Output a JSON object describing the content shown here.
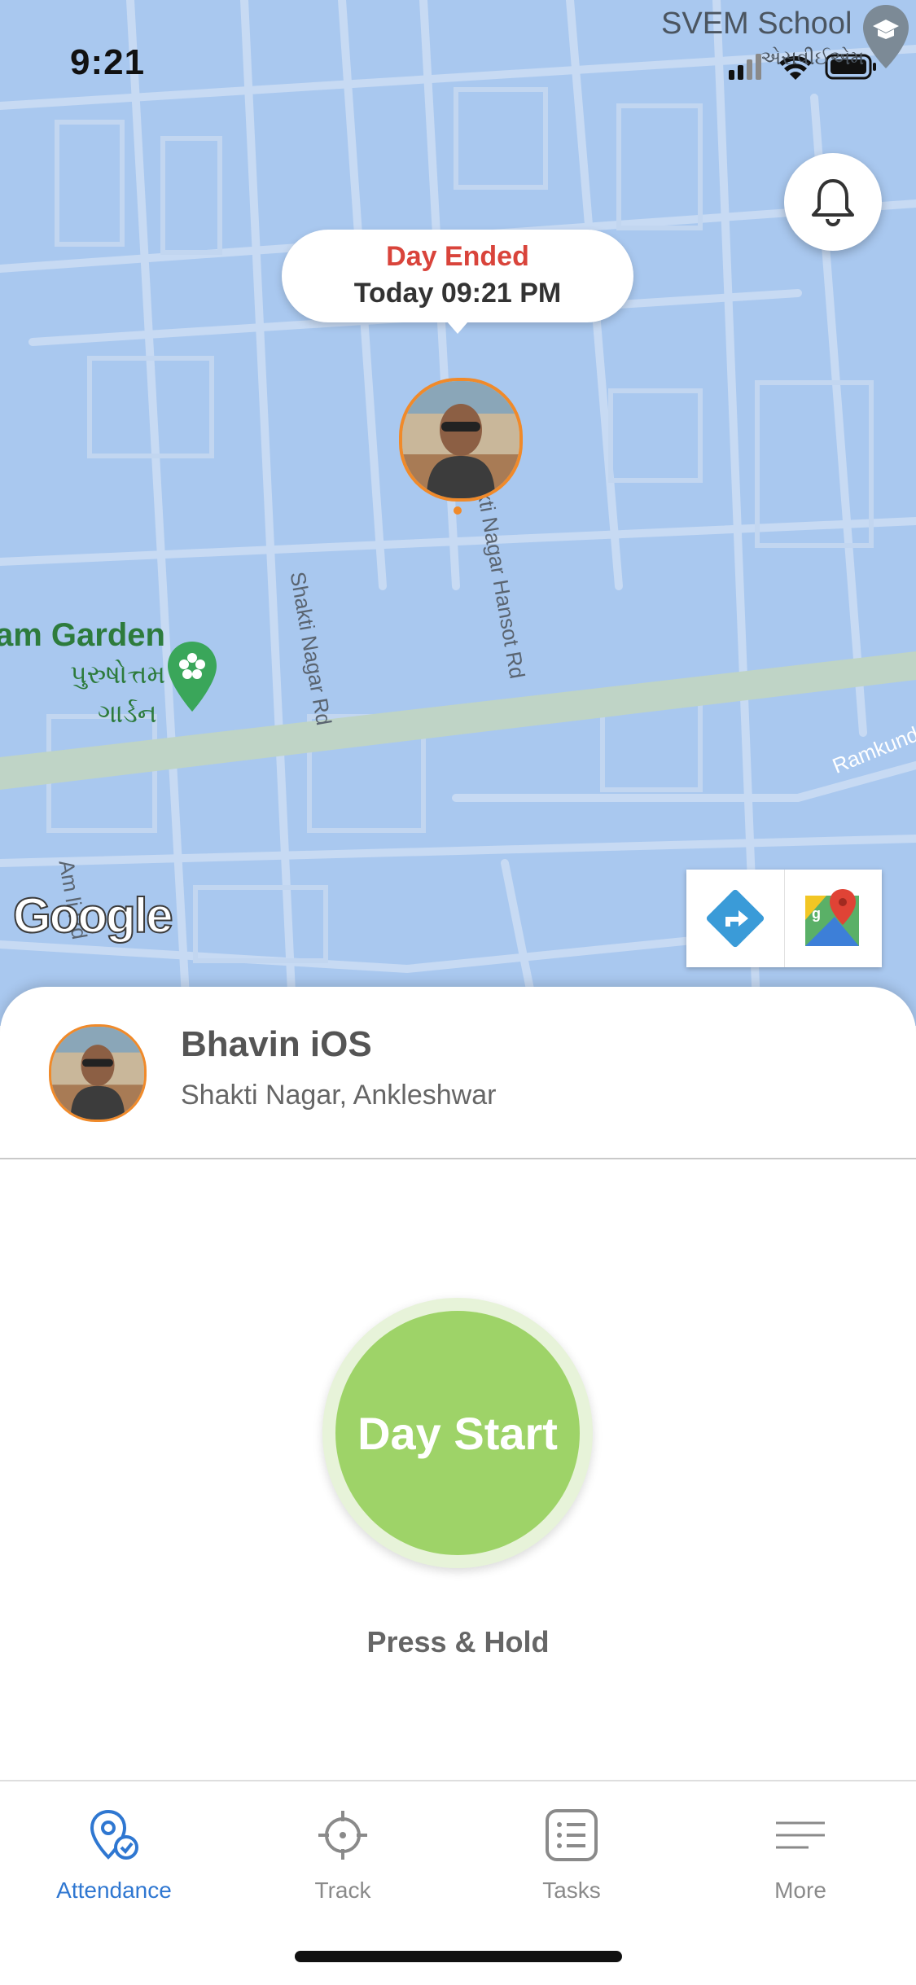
{
  "status_bar": {
    "time": "9:21"
  },
  "map": {
    "labels": {
      "school": "SVEM School",
      "school_sub": "એસવીઈએમ",
      "garden": "am Garden",
      "garden_gu_line1": "પુરુષોત્તમ",
      "garden_gu_line2": "ગાર્ડન",
      "road_shakti": "Shakti Nagar Rd",
      "road_hansot": "kti Nagar Hansot Rd",
      "road_ramkund": "Ramkund",
      "road_am": "Am        li Rd"
    },
    "logo_text": "Google",
    "bubble": {
      "title": "Day Ended",
      "subtitle": "Today 09:21 PM"
    },
    "colors": {
      "water": "#a9c8ef",
      "accent_orange": "#f08a2a",
      "ended_red": "#d9443b"
    }
  },
  "profile": {
    "name": "Bhavin iOS",
    "location": "Shakti Nagar, Ankleshwar"
  },
  "action": {
    "button_label": "Day Start",
    "hint": "Press & Hold",
    "color": "#9ed368"
  },
  "tabs": [
    {
      "label": "Attendance",
      "icon": "attendance-pin-icon",
      "active": true
    },
    {
      "label": "Track",
      "icon": "crosshair-icon",
      "active": false
    },
    {
      "label": "Tasks",
      "icon": "tasks-list-icon",
      "active": false
    },
    {
      "label": "More",
      "icon": "menu-lines-icon",
      "active": false
    }
  ]
}
